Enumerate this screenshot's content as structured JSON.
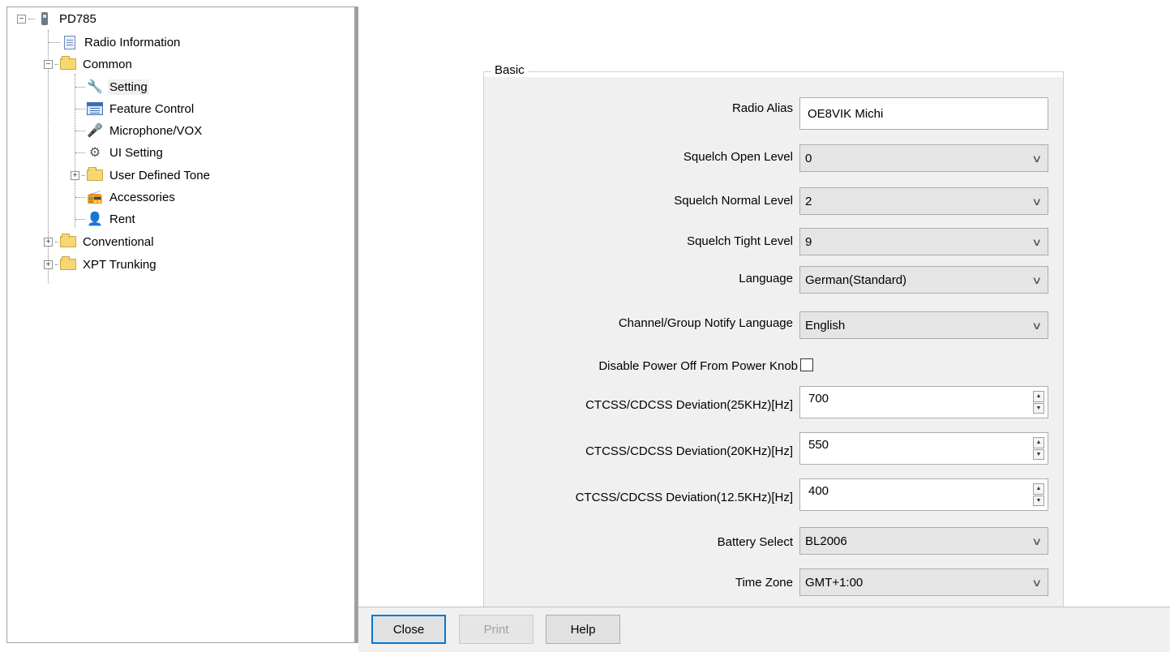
{
  "tree": {
    "root": {
      "label": "PD785",
      "icon": "radio-device-icon"
    },
    "items": [
      {
        "label": "Radio Information",
        "icon": "document-icon"
      },
      {
        "label": "Common",
        "icon": "folder-open-icon"
      },
      {
        "label": "Setting",
        "icon": "wrench-icon"
      },
      {
        "label": "Feature Control",
        "icon": "list-icon"
      },
      {
        "label": "Microphone/VOX",
        "icon": "microphone-icon"
      },
      {
        "label": "UI Setting",
        "icon": "ui-settings-icon"
      },
      {
        "label": "User Defined Tone",
        "icon": "folder-icon"
      },
      {
        "label": "Accessories",
        "icon": "accessories-icon"
      },
      {
        "label": "Rent",
        "icon": "rent-icon"
      },
      {
        "label": "Conventional",
        "icon": "folder-icon"
      },
      {
        "label": "XPT Trunking",
        "icon": "folder-icon"
      }
    ],
    "expand_glyph": "+",
    "collapse_glyph": "−"
  },
  "form": {
    "group_title": "Basic",
    "radio_alias": {
      "label": "Radio Alias",
      "value": "OE8VIK Michi"
    },
    "squelch_open": {
      "label": "Squelch Open Level",
      "value": "0"
    },
    "squelch_normal": {
      "label": "Squelch Normal Level",
      "value": "2"
    },
    "squelch_tight": {
      "label": "Squelch Tight Level",
      "value": "9"
    },
    "language": {
      "label": "Language",
      "value": "German(Standard)"
    },
    "notify_language": {
      "label": "Channel/Group Notify Language",
      "value": "English"
    },
    "disable_power_off": {
      "label": "Disable Power Off From Power Knob",
      "checked": false
    },
    "deviation_25": {
      "label": "CTCSS/CDCSS Deviation(25KHz)[Hz]",
      "value": "700"
    },
    "deviation_20": {
      "label": "CTCSS/CDCSS Deviation(20KHz)[Hz]",
      "value": "550"
    },
    "deviation_125": {
      "label": "CTCSS/CDCSS Deviation(12.5KHz)[Hz]",
      "value": "400"
    },
    "battery": {
      "label": "Battery Select",
      "value": "BL2006"
    },
    "time_zone": {
      "label": "Time Zone",
      "value": "GMT+1:00"
    },
    "chevron": "∨",
    "spin_up": "▲",
    "spin_down": "▼"
  },
  "buttons": {
    "close": "Close",
    "print": "Print",
    "help": "Help"
  },
  "colors": {
    "focus_border": "#0078d7",
    "panel_bg": "#f0f0f0",
    "folder": "#f7d774"
  }
}
